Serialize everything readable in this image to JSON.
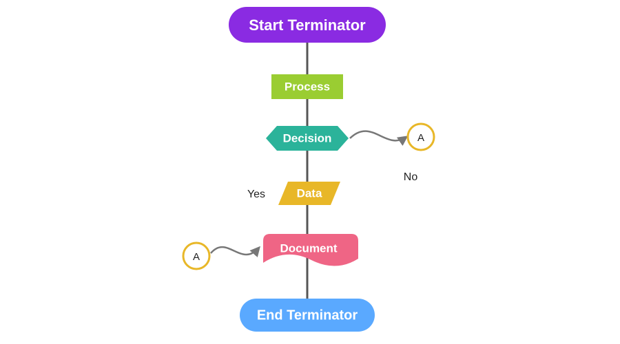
{
  "flowchart": {
    "nodes": {
      "start": {
        "label": "Start Terminator",
        "kind": "terminator",
        "fill": "#8a2be2"
      },
      "process": {
        "label": "Process",
        "kind": "process",
        "fill": "#9acd32"
      },
      "decision": {
        "label": "Decision",
        "kind": "decision",
        "fill": "#2bb39a"
      },
      "data": {
        "label": "Data",
        "kind": "data",
        "fill": "#e8b728"
      },
      "document": {
        "label": "Document",
        "kind": "document",
        "fill": "#ef6585"
      },
      "end": {
        "label": "End Terminator",
        "kind": "terminator",
        "fill": "#5aa9ff"
      },
      "connA1": {
        "label": "A",
        "kind": "connector",
        "stroke": "#e8b728"
      },
      "connA2": {
        "label": "A",
        "kind": "connector",
        "stroke": "#e8b728"
      }
    },
    "edge_labels": {
      "yes": "Yes",
      "no": "No"
    }
  }
}
